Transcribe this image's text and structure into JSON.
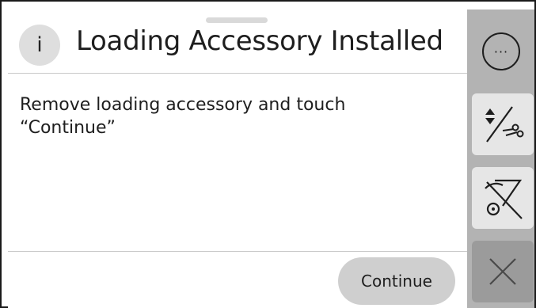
{
  "dialog": {
    "icon": "info-icon",
    "icon_glyph": "i",
    "title": "Loading Accessory Installed",
    "message": "Remove loading accessory and touch “Continue”",
    "continue_label": "Continue"
  },
  "sidebar": {
    "more_label": "···",
    "buttons": [
      {
        "name": "cut-paper-icon"
      },
      {
        "name": "no-cut-icon"
      },
      {
        "name": "close-icon"
      }
    ]
  },
  "colors": {
    "sidebar_bg": "#b3b3b3",
    "button_bg": "#cfcfcf",
    "text": "#1e1e1e"
  }
}
